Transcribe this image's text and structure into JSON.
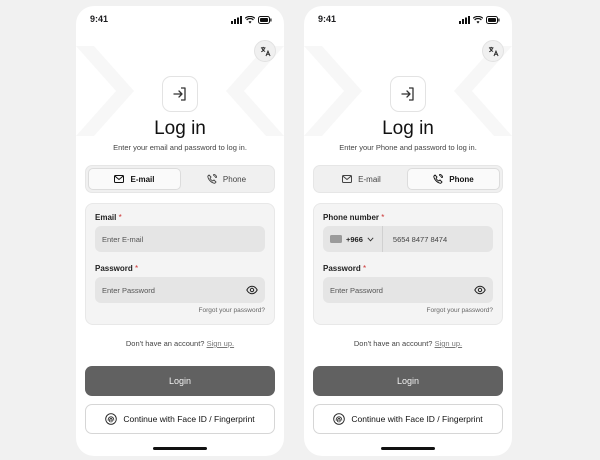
{
  "screens": [
    {
      "status_time": "9:41",
      "title": "Log in",
      "subtitle": "Enter your email and password to log in.",
      "tabs": [
        {
          "label": "E-mail",
          "active": true,
          "icon": "mail-icon"
        },
        {
          "label": "Phone",
          "active": false,
          "icon": "phone-icon"
        }
      ],
      "field1_label": "Email",
      "field1_required": "*",
      "field1_placeholder": "Enter E-mail",
      "password_label": "Password",
      "password_required": "*",
      "password_placeholder": "Enter Password",
      "forgot_password": "Forgot your password?",
      "signup_prompt": "Don't have an account?",
      "signup_link": "Sign up.",
      "login_button": "Login",
      "biometric_button": "Continue with Face ID / Fingerprint"
    },
    {
      "status_time": "9:41",
      "title": "Log in",
      "subtitle": "Enter your Phone and password to log in.",
      "tabs": [
        {
          "label": "E-mail",
          "active": false,
          "icon": "mail-icon"
        },
        {
          "label": "Phone",
          "active": true,
          "icon": "phone-icon"
        }
      ],
      "field1_label": "Phone number",
      "field1_required": "*",
      "country_code": "+966",
      "phone_value": "5654 8477 8474",
      "password_label": "Password",
      "password_required": "*",
      "password_placeholder": "Enter Password",
      "forgot_password": "Forgot your password?",
      "signup_prompt": "Don't have an account?",
      "signup_link": "Sign up.",
      "login_button": "Login",
      "biometric_button": "Continue with Face ID / Fingerprint"
    }
  ],
  "colors": {
    "background": "#f1f1f1",
    "primary_button": "#616161",
    "input_fill": "#e5e5e5",
    "required_marker": "#cc3333"
  }
}
